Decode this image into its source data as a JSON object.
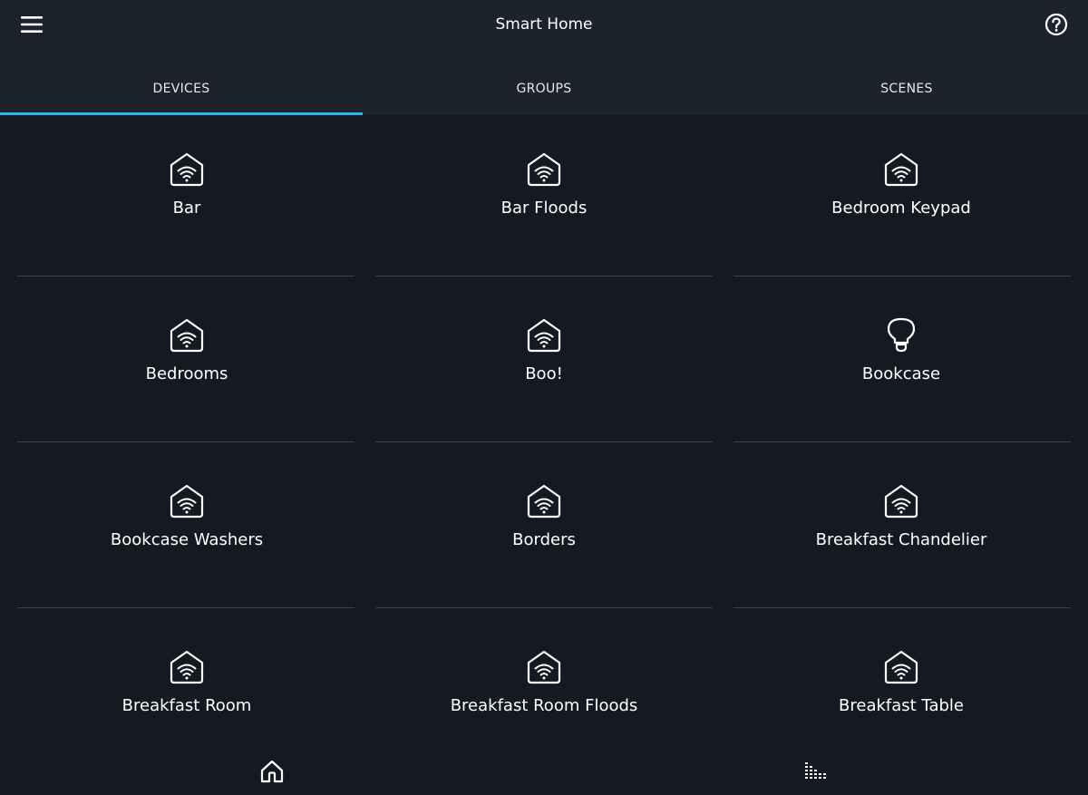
{
  "header": {
    "title": "Smart Home",
    "menu_icon": "hamburger-menu-icon",
    "help_icon": "help-circle-icon"
  },
  "tabs": [
    {
      "label": "DEVICES",
      "active": true
    },
    {
      "label": "GROUPS",
      "active": false
    },
    {
      "label": "SCENES",
      "active": false
    }
  ],
  "devices": [
    {
      "label": "Bar",
      "icon": "smart-home-icon"
    },
    {
      "label": "Bar Floods",
      "icon": "smart-home-icon"
    },
    {
      "label": "Bedroom Keypad",
      "icon": "smart-home-icon"
    },
    {
      "label": "Bedrooms",
      "icon": "smart-home-icon"
    },
    {
      "label": "Boo!",
      "icon": "smart-home-icon"
    },
    {
      "label": "Bookcase",
      "icon": "light-bulb-icon"
    },
    {
      "label": "Bookcase Washers",
      "icon": "smart-home-icon"
    },
    {
      "label": "Borders",
      "icon": "smart-home-icon"
    },
    {
      "label": "Breakfast Chandelier",
      "icon": "smart-home-icon"
    },
    {
      "label": "Breakfast Room",
      "icon": "smart-home-icon"
    },
    {
      "label": "Breakfast Room Floods",
      "icon": "smart-home-icon"
    },
    {
      "label": "Breakfast Table",
      "icon": "smart-home-icon"
    }
  ],
  "bottom_nav": {
    "home_icon": "home-nav-icon",
    "stats_icon": "equalizer-icon"
  },
  "colors": {
    "background": "#151a22",
    "header": "#1c232c",
    "accent": "#30b3e6",
    "divider": "#3a414b"
  }
}
